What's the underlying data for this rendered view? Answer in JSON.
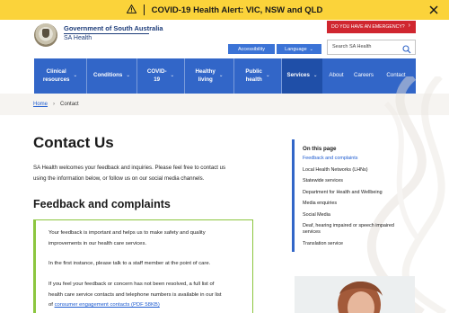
{
  "alert": {
    "text": "COVID-19 Health Alert: VIC, NSW and QLD",
    "icon": "warning-icon",
    "close_icon": "close-icon"
  },
  "header": {
    "logo_title": "Government of South Australia",
    "logo_subtitle": "SA Health",
    "emergency_label": "DO YOU HAVE AN EMERGENCY?",
    "accessibility_label": "Accessibility",
    "language_label": "Language",
    "search_placeholder": "Search SA Health"
  },
  "nav": {
    "items": [
      {
        "label": "Clinical\nresources"
      },
      {
        "label": "Conditions"
      },
      {
        "label": "COVID-\n19"
      },
      {
        "label": "Healthy\nliving"
      },
      {
        "label": "Public\nhealth"
      },
      {
        "label": "Services"
      },
      {
        "label": "About"
      },
      {
        "label": "Careers"
      },
      {
        "label": "Contact"
      }
    ]
  },
  "breadcrumb": {
    "home": "Home",
    "current": "Contact"
  },
  "main": {
    "title": "Contact Us",
    "intro_1": "SA Health welcomes your feedback and inquiries. Please feel free to contact us",
    "intro_2": "using the information below, or follow us on our social media channels.",
    "section_title": "Feedback and complaints",
    "callout_1a": "Your feedback is important and helps us to make safety and quality",
    "callout_1b": "improvements in our health care services.",
    "callout_2": "In the first instance, please talk to a staff member at the point of care.",
    "callout_3a": "If you feel your feedback or concern has not been resolved, a full list of",
    "callout_3b": "health care service contacts and telephone numbers is available in our list",
    "callout_3c": "of",
    "callout_link": "consumer engagement contacts (PDF 58KB)"
  },
  "on_this_page": {
    "title": "On this page",
    "links": [
      {
        "label": "Feedback and complaints"
      },
      {
        "label": "Local Health Networks (LHNs)"
      },
      {
        "label": "Statewide services"
      },
      {
        "label": "Department for Health and Wellbeing"
      },
      {
        "label": "Media enquiries"
      },
      {
        "label": "Social Media"
      },
      {
        "label": "Deaf, hearing impaired or speech impaired services"
      },
      {
        "label": "Translation service"
      }
    ]
  },
  "colors": {
    "alert_bg": "#fbd33a",
    "nav_bg": "#3266c8",
    "emergency_bg": "#d0262f",
    "link": "#1d5bd0",
    "callout_border": "#8cc63f"
  }
}
